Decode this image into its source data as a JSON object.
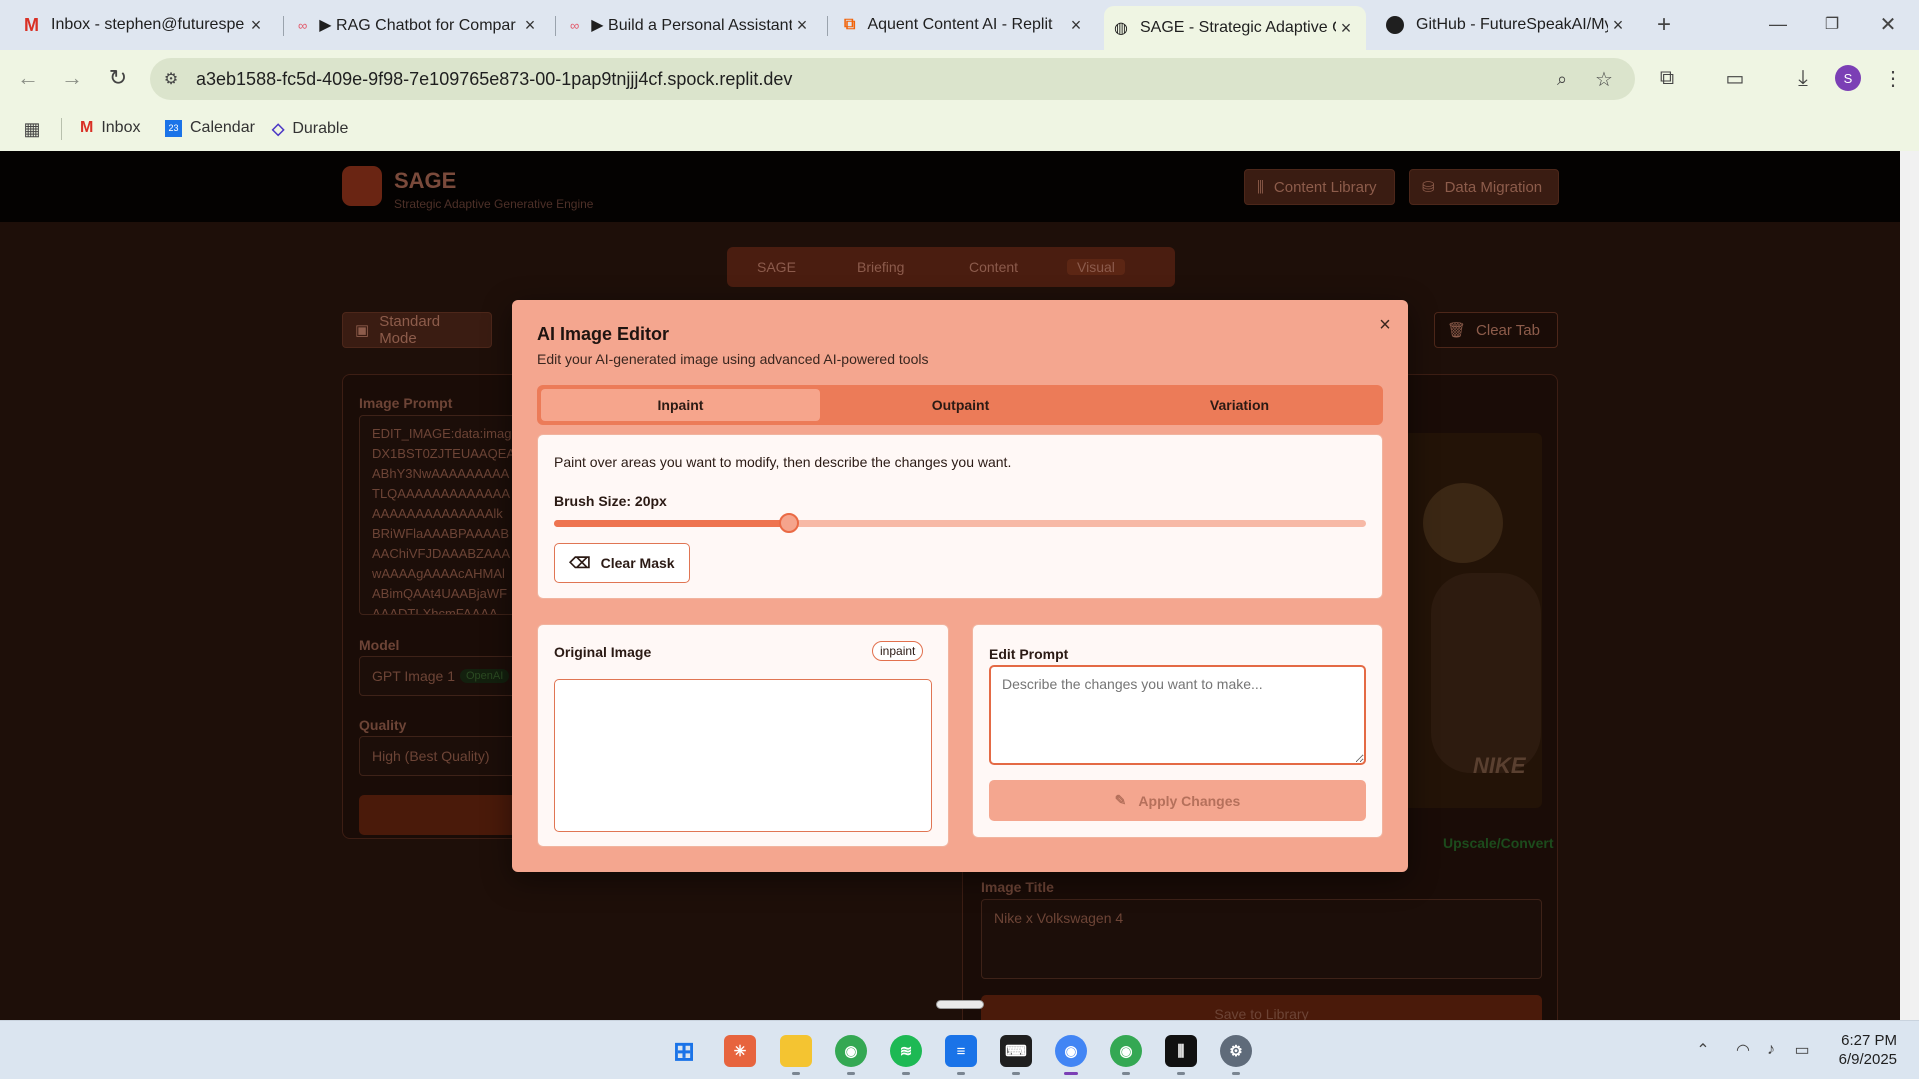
{
  "browser": {
    "tabs": [
      {
        "title": "Inbox - stephen@futurespe",
        "icon": "gmail-icon"
      },
      {
        "title": "▶ RAG Chatbot for Compar",
        "icon": "n8n-icon"
      },
      {
        "title": "▶ Build a Personal Assistant",
        "icon": "n8n-icon"
      },
      {
        "title": "Aquent Content AI - Replit",
        "icon": "replit-icon"
      },
      {
        "title": "SAGE - Strategic Adaptive G",
        "icon": "globe-icon",
        "active": true
      },
      {
        "title": "GitHub - FutureSpeakAI/My",
        "icon": "github-icon"
      }
    ],
    "url": "a3eb1588-fc5d-409e-9f98-7e109765e873-00-1pap9tnjjj4cf.spock.replit.dev",
    "profile_initial": "S",
    "bookmarks": [
      "Inbox",
      "Calendar",
      "Durable"
    ]
  },
  "app": {
    "brand": "SAGE",
    "brand_subtitle": "Strategic Adaptive Generative Engine",
    "header_buttons": [
      "Content Library",
      "Data Migration"
    ],
    "nav": [
      "SAGE",
      "Briefing",
      "Content",
      "Visual"
    ],
    "mode_button": "Standard Mode",
    "clear_tab": "Clear Tab",
    "image_prompt_label": "Image Prompt",
    "image_prompt_lines": [
      "EDIT_IMAGE:data:imag",
      "DX1BST0ZJTEUAAQEA",
      "ABhY3NwAAAAAAAAA",
      "TLQAAAAAAAAAAAAA",
      "AAAAAAAAAAAAAAlk",
      "BRiWFlaAAABPAAAAB",
      "AAChiVFJDAAABZAAA",
      "wAAAAgAAAAcAHMAl",
      "ABimQAAt4UAABjaWF",
      "AAADTLXhcmFAAAA"
    ],
    "model_label": "Model",
    "model_value": "GPT Image 1",
    "model_badge": "OpenAI",
    "quality_label": "Quality",
    "quality_value": "High (Best Quality)",
    "upscale_label": "Upscale/Convert",
    "image_title_label": "Image Title",
    "image_title_value": "Nike x Volkswagen 4",
    "save_label": "Save to Library"
  },
  "modal": {
    "title": "AI Image Editor",
    "subtitle": "Edit your AI-generated image using advanced AI-powered tools",
    "tabs": [
      "Inpaint",
      "Outpaint",
      "Variation"
    ],
    "active_tab": "Inpaint",
    "instruction": "Paint over areas you want to modify, then describe the changes you want.",
    "brush_label": "Brush Size: 20px",
    "brush_fraction": 0.29,
    "clear_mask": "Clear Mask",
    "original_image_label": "Original Image",
    "mode_badge": "inpaint",
    "edit_prompt_label": "Edit Prompt",
    "edit_prompt_placeholder": "Describe the changes you want to make...",
    "apply_button": "Apply Changes"
  },
  "taskbar": {
    "time": "6:27 PM",
    "date": "6/9/2025"
  },
  "colors": {
    "accent": "#ee7450",
    "modal_bg": "#f4a68f",
    "overlay_dark": "#1e0f09"
  }
}
